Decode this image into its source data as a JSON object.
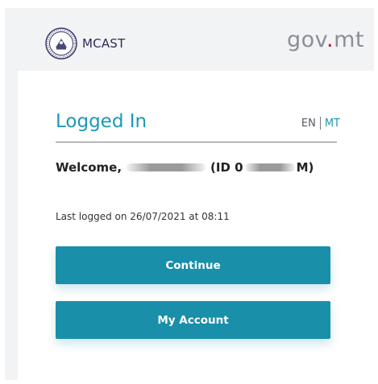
{
  "header": {
    "brand": "MCAST",
    "gov_prefix": "gov",
    "gov_dot": ".",
    "gov_suffix": "mt",
    "logo_icon": "mcast-seal-icon",
    "colors": {
      "brand": "#2c2c55",
      "gov": "#8a8f98",
      "gov_dot": "#c8102e"
    }
  },
  "card": {
    "title": "Logged In",
    "lang": {
      "en": "EN",
      "mt": "MT"
    },
    "welcome": {
      "prefix": "Welcome,",
      "id_prefix": "(ID 0",
      "id_suffix": "M)"
    },
    "last_logged": "Last logged on 26/07/2021 at 08:11",
    "buttons": {
      "continue": "Continue",
      "my_account": "My Account"
    },
    "colors": {
      "accent": "#1d98b3",
      "button": "#1a8faa"
    }
  }
}
